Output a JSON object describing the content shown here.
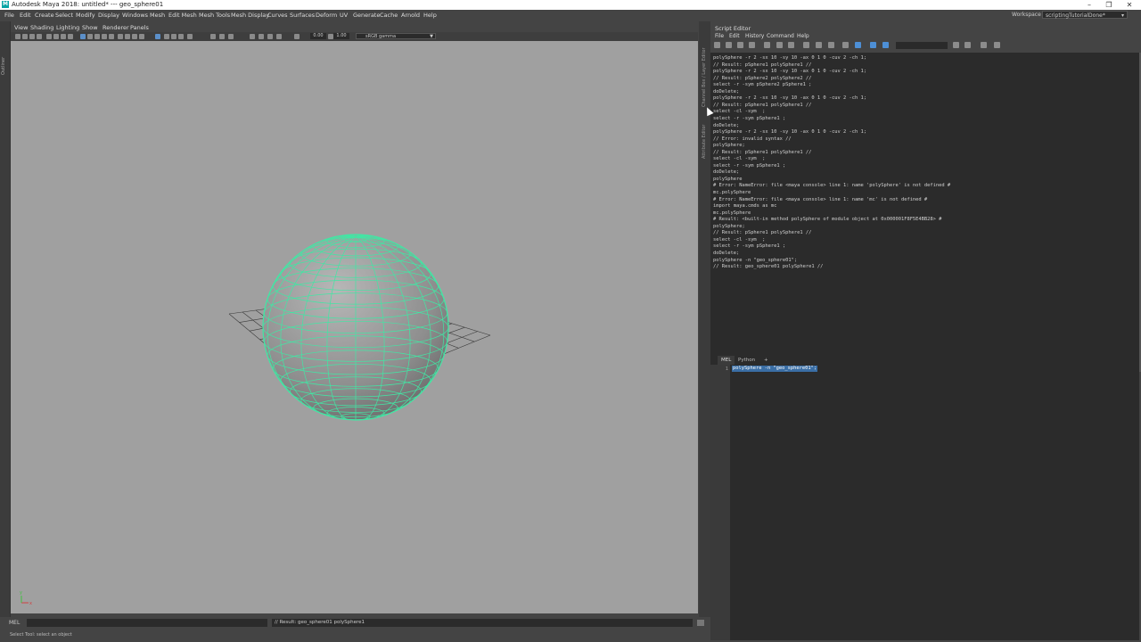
{
  "window": {
    "title": "Autodesk Maya 2018: untitled*   ---   geo_sphere01",
    "app_icon": "M",
    "minimize": "–",
    "restore": "❐",
    "close": "✕"
  },
  "main_menu": [
    "File",
    "Edit",
    "Create",
    "Select",
    "Modify",
    "Display",
    "Windows",
    "Mesh",
    "Edit Mesh",
    "Mesh Tools",
    "Mesh Display",
    "Curves",
    "Surfaces",
    "Deform",
    "UV",
    "Generate",
    "Cache",
    "Arnold",
    "Help"
  ],
  "workspace": {
    "label": "Workspace :",
    "value": "scriptingTutorialDone*"
  },
  "left_strip": {
    "tab": "Outliner"
  },
  "viewport": {
    "menu": [
      "View",
      "Shading",
      "Lighting",
      "Show",
      "Renderer",
      "Panels"
    ],
    "exposure": "0.00",
    "gamma": "1.00",
    "colorspace": "sRGB gamma",
    "background": "#a0a0a0",
    "wire_color": "#42e6a4",
    "axis_labels": {
      "x": "x",
      "y": "y"
    }
  },
  "command_line": {
    "language": "MEL",
    "result": "// Result: geo_sphere01 polySphere1"
  },
  "help_line": "Select Tool: select an object",
  "mid_strip": {
    "tabs": [
      "Channel Box / Layer Editor",
      "Attribute Editor"
    ]
  },
  "script_editor": {
    "title": "Script Editor",
    "menus": [
      "File",
      "Edit",
      "History",
      "Command",
      "Help"
    ],
    "history": [
      "polySphere -r 2 -sx 10 -sy 10 -ax 0 1 0 -cuv 2 -ch 1;",
      "// Result: pSphere1 polySphere1 //",
      "polySphere -r 2 -sx 10 -sy 10 -ax 0 1 0 -cuv 2 -ch 1;",
      "// Result: pSphere2 polySphere2 //",
      "select -r -sym pSphere2 pSphere1 ;",
      "doDelete;",
      "polySphere -r 2 -sx 10 -sy 10 -ax 0 1 0 -cuv 2 -ch 1;",
      "// Result: pSphere1 polySphere1 //",
      "select -cl -sym  ;",
      "select -r -sym pSphere1 ;",
      "doDelete;",
      "polySphere -r 2 -sx 10 -sy 10 -ax 0 1 0 -cuv 2 -ch 1;",
      "// Error: invalid syntax //",
      "polySphere;",
      "// Result: pSphere1 polySphere1 //",
      "select -cl -sym  ;",
      "select -r -sym pSphere1 ;",
      "doDelete;",
      "polySphere",
      "# Error: NameError: file <maya console> line 1: name 'polySphere' is not defined #",
      "mc.polySphere",
      "# Error: NameError: file <maya console> line 1: name 'mc' is not defined #",
      "import maya.cmds as mc",
      "mc.polySphere",
      "# Result: <built-in method polySphere of module object at 0x000001F8F5E4BB28> #",
      "polySphere;",
      "// Result: pSphere1 polySphere1 //",
      "select -cl -sym  ;",
      "select -r -sym pSphere1 ;",
      "doDelete;",
      "polySphere -n \"geo_sphere01\";",
      "// Result: geo_sphere01 polySphere1 //"
    ],
    "tabs": [
      "MEL",
      "Python",
      "+"
    ],
    "input_line_number": "1",
    "input_text": "polySphere -n \"geo_sphere01\";"
  }
}
